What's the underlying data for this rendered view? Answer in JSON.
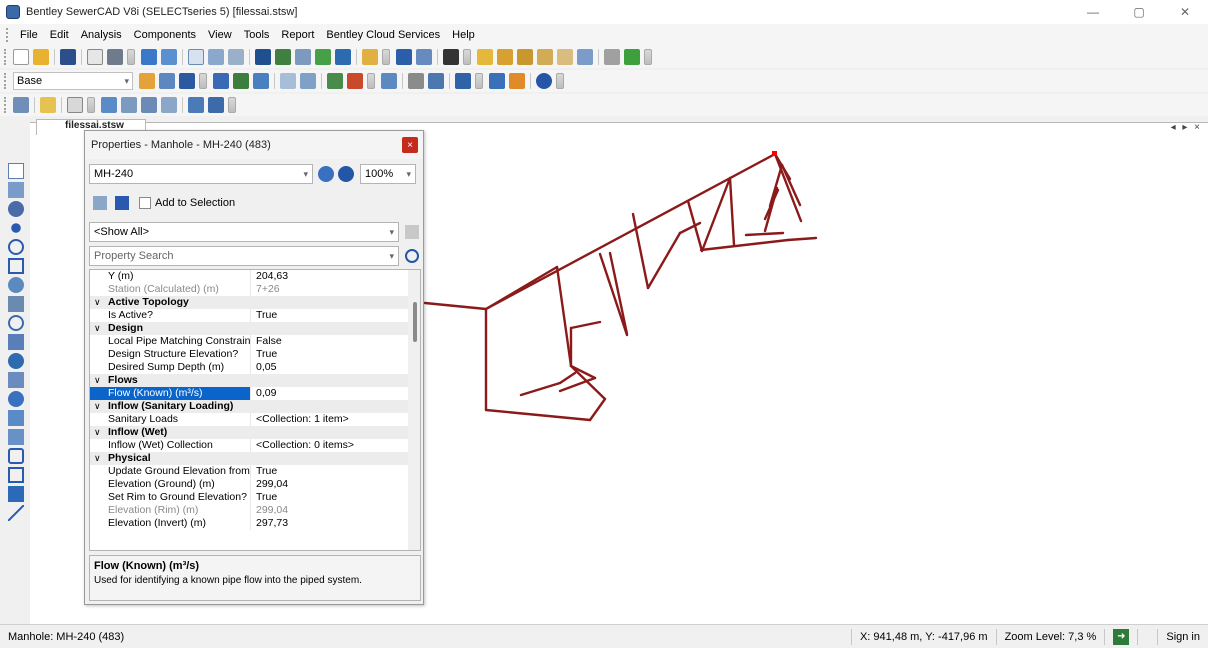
{
  "app": {
    "title": "Bentley SewerCAD V8i (SELECTseries 5) [filessai.stsw]",
    "window_buttons": [
      "—",
      "▢",
      "✕"
    ]
  },
  "menu": [
    "File",
    "Edit",
    "Analysis",
    "Components",
    "View",
    "Tools",
    "Report",
    "Bentley Cloud Services",
    "Help"
  ],
  "toolbar": {
    "base_label": "Base",
    "base_dropdown": "▾"
  },
  "document": {
    "tab_label": "filessai.stsw",
    "tab_nav": "◂ ▸ ×"
  },
  "properties": {
    "title": "Properties - Manhole - MH-240 (483)",
    "close": "×",
    "element_select": "MH-240",
    "zoom": "100%",
    "add_to_selection": "Add to Selection",
    "filter": "<Show All>",
    "search_placeholder": "Property Search",
    "rows": [
      {
        "k": "Y (m)",
        "v": "204,63"
      },
      {
        "k": "Station (Calculated) (m)",
        "v": "7+26",
        "dim": true
      },
      {
        "cat": "Active Topology"
      },
      {
        "k": "Is Active?",
        "v": "True"
      },
      {
        "cat": "Design"
      },
      {
        "k": "Local Pipe Matching Constraints",
        "v": "False"
      },
      {
        "k": "Design Structure Elevation?",
        "v": "True"
      },
      {
        "k": "Desired Sump Depth (m)",
        "v": "0,05"
      },
      {
        "cat": "Flows"
      },
      {
        "k": "Flow (Known) (m³/s)",
        "v": "0,09",
        "sel": true
      },
      {
        "cat": "Inflow (Sanitary Loading)"
      },
      {
        "k": "Sanitary Loads",
        "v": "<Collection: 1 item>"
      },
      {
        "cat": "Inflow (Wet)"
      },
      {
        "k": "Inflow (Wet) Collection",
        "v": "<Collection: 0 items>"
      },
      {
        "cat": "Physical"
      },
      {
        "k": "Update Ground Elevation from T",
        "v": "True"
      },
      {
        "k": "Elevation (Ground) (m)",
        "v": "299,04"
      },
      {
        "k": "Set Rim to Ground Elevation?",
        "v": "True"
      },
      {
        "k": "Elevation (Rim) (m)",
        "v": "299,04",
        "dim": true
      },
      {
        "k": "Elevation (Invert) (m)",
        "v": "297,73"
      }
    ],
    "description_title": "Flow (Known) (m³/s)",
    "description_text": "Used for identifying a known pipe flow into the piped system."
  },
  "status": {
    "left": "Manhole:  MH-240 (483)",
    "coords": "X: 941,48 m, Y: -417,96 m",
    "zoom": "Zoom Level: 7,3 %",
    "sign_in": "Sign in"
  },
  "colors": {
    "pipe": "#8b1a1a",
    "selected_node": "#ff0000",
    "selection": "#0a64c9"
  }
}
